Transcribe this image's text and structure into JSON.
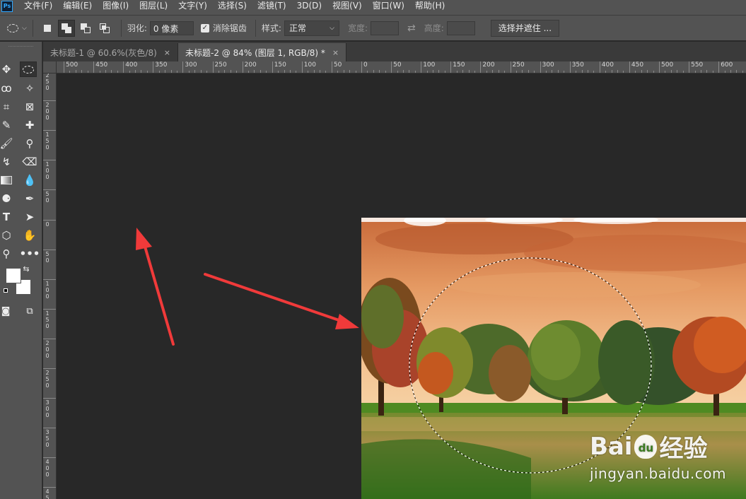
{
  "menu": {
    "logo": "Ps",
    "items": [
      "文件(F)",
      "编辑(E)",
      "图像(I)",
      "图层(L)",
      "文字(Y)",
      "选择(S)",
      "滤镜(T)",
      "3D(D)",
      "视图(V)",
      "窗口(W)",
      "帮助(H)"
    ]
  },
  "options": {
    "feather_label": "羽化:",
    "feather_value": "0 像素",
    "antialias_label": "消除锯齿",
    "antialias_checked": "✓",
    "style_label": "样式:",
    "style_value": "正常",
    "width_label": "宽度:",
    "height_label": "高度:",
    "select_mask_button": "选择并遮住 ..."
  },
  "tabs": [
    {
      "label": "未标题-1 @ 60.6%(灰色/8)",
      "close": "×"
    },
    {
      "label": "未标题-2 @ 84% (图层 1, RGB/8) *",
      "close": "×"
    }
  ],
  "ruler_top_labels": [
    "500",
    "450",
    "400",
    "350",
    "300",
    "250",
    "200",
    "150",
    "100",
    "50",
    "0",
    "50",
    "100",
    "150",
    "200",
    "250",
    "300",
    "350",
    "400",
    "450",
    "500",
    "550",
    "600"
  ],
  "ruler_left_labels": [
    [
      "2",
      "5",
      "0"
    ],
    [
      "2",
      "0",
      "0"
    ],
    [
      "1",
      "5",
      "0"
    ],
    [
      "1",
      "0",
      "0"
    ],
    [
      "5",
      "0"
    ],
    [
      "0"
    ],
    [
      "5",
      "0"
    ],
    [
      "1",
      "0",
      "0"
    ],
    [
      "1",
      "5",
      "0"
    ],
    [
      "2",
      "0",
      "0"
    ],
    [
      "2",
      "5",
      "0"
    ],
    [
      "3",
      "0",
      "0"
    ],
    [
      "3",
      "5",
      "0"
    ],
    [
      "4",
      "0",
      "0"
    ],
    [
      "4",
      "5"
    ]
  ],
  "watermark": {
    "logo_text": "Bai",
    "logo_text2": "du",
    "brand_cn": "经验",
    "url": "jingyan.baidu.com"
  },
  "colors": {
    "arrow": "#f03a3a",
    "panel": "#535353",
    "canvas": "#282828"
  }
}
